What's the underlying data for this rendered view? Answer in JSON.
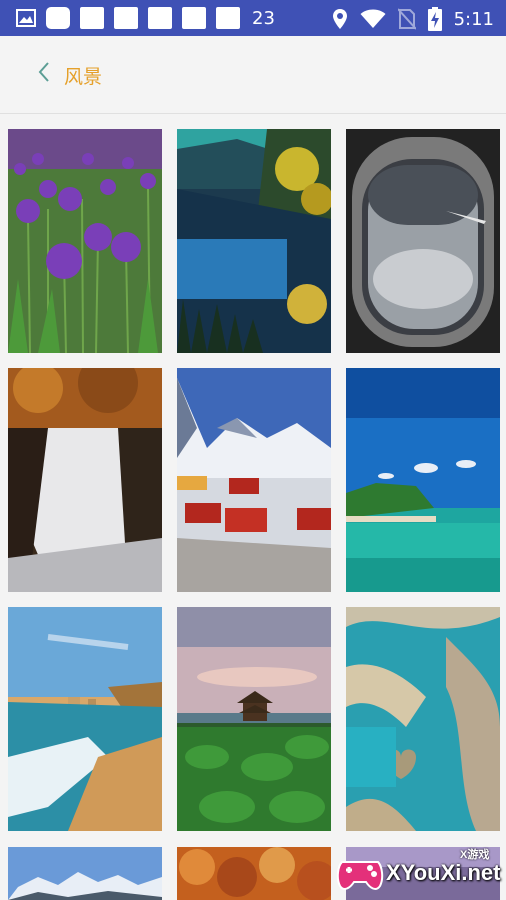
{
  "status_bar": {
    "notification_count": "23",
    "time": "5:11"
  },
  "header": {
    "title": "风景"
  },
  "grid": {
    "items": [
      {
        "subject": "purple allium flower field"
      },
      {
        "subject": "autumn lake reflection"
      },
      {
        "subject": "airplane window view"
      },
      {
        "subject": "autumn waterfall"
      },
      {
        "subject": "snowy village with red cabins"
      },
      {
        "subject": "tropical island beach"
      },
      {
        "subject": "coastal cliffs and beach"
      },
      {
        "subject": "pavilion over lotus pond"
      },
      {
        "subject": "aerial coral reef heart"
      },
      {
        "subject": "snowy mountains"
      },
      {
        "subject": "autumn forest"
      },
      {
        "subject": "partial thumbnail"
      }
    ]
  },
  "watermark": {
    "brand": "XYouXi.net",
    "tagline": "X游戏"
  },
  "colors": {
    "status_bar": "#3f51b5",
    "title": "#e5a02a",
    "back_icon": "#5c9e95",
    "background": "#f4f4f4"
  }
}
